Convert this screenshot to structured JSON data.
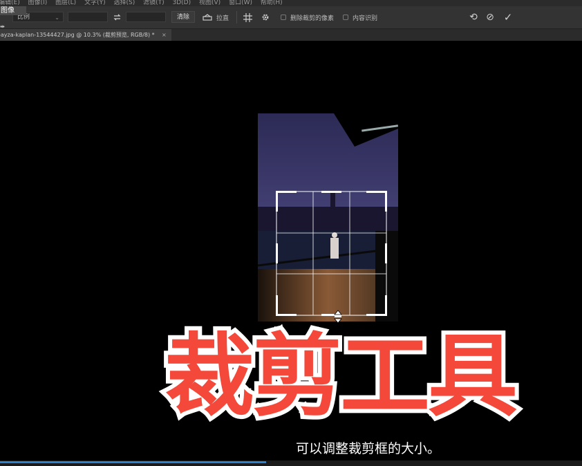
{
  "menubar": {
    "items": [
      "编辑(E)",
      "图像(I)",
      "图层(L)",
      "文字(Y)",
      "选择(S)",
      "滤镜(T)",
      "3D(D)",
      "视图(V)",
      "窗口(W)",
      "帮助(H)"
    ]
  },
  "tool_corner_label": "图像",
  "side_mark": "⇹",
  "options": {
    "ratio_select": "比例",
    "swap_icon": "swap-icon",
    "clear_button": "清除",
    "straighten_label": "拉直",
    "delete_cropped_label": "删除裁剪的像素",
    "content_aware_label": "内容识别",
    "reset_icon": "⟲",
    "cancel_icon": "⊘",
    "commit_icon": "✓"
  },
  "document_tab": {
    "title": "-ayza-kaplan-13544427.jpg @ 10.3% (裁剪预览, RGB/8) *",
    "close": "×"
  },
  "overlay": {
    "title": "裁剪工具",
    "subtitle": "可以调整裁剪框的大小。"
  },
  "colors": {
    "title_red": "#f4483a",
    "progress_blue": "#2f7fd0",
    "panel": "#333333"
  }
}
